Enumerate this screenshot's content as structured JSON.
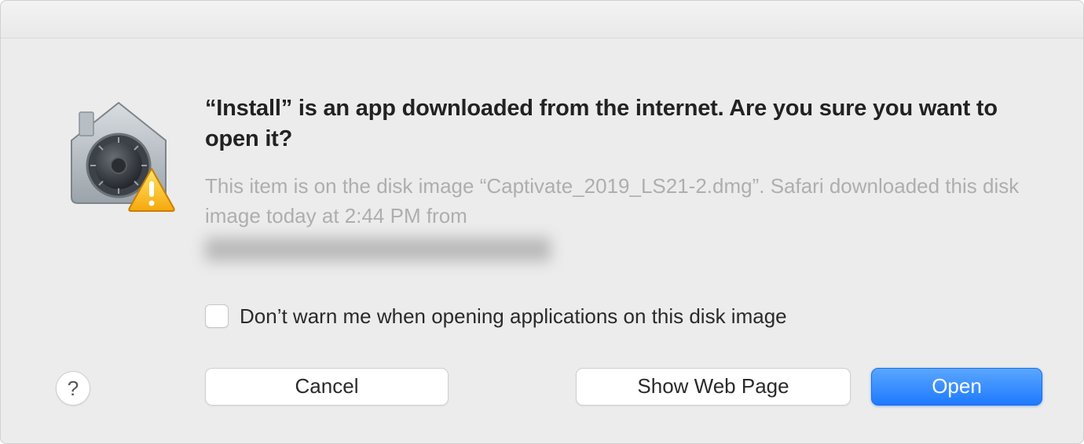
{
  "dialog": {
    "headline": "“Install” is an app downloaded from the internet. Are you sure you want to open it?",
    "description": "This item is on the disk image “Captivate_2019_LS21-2.dmg”. Safari downloaded this disk image today at 2:44 PM from",
    "checkbox_label": "Don’t warn me when opening applications on this disk image",
    "help_label": "?",
    "buttons": {
      "cancel": "Cancel",
      "show_web_page": "Show Web Page",
      "open": "Open"
    }
  }
}
